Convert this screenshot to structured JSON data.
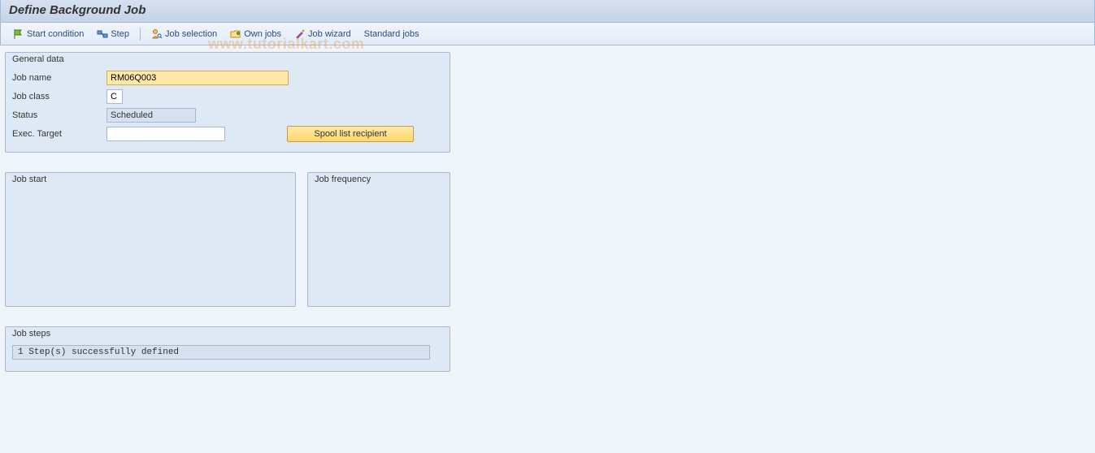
{
  "title": "Define Background Job",
  "toolbar": {
    "start_condition": "Start condition",
    "step": "Step",
    "job_selection": "Job selection",
    "own_jobs": "Own jobs",
    "job_wizard": "Job wizard",
    "standard_jobs": "Standard jobs"
  },
  "general": {
    "title": "General data",
    "job_name_label": "Job name",
    "job_name_value": "RM06Q003",
    "job_class_label": "Job class",
    "job_class_value": "C",
    "status_label": "Status",
    "status_value": "Scheduled",
    "exec_target_label": "Exec. Target",
    "exec_target_value": "",
    "spool_button": "Spool list recipient"
  },
  "job_start": {
    "title": "Job start"
  },
  "job_frequency": {
    "title": "Job frequency"
  },
  "job_steps": {
    "title": "Job steps",
    "message": "1 Step(s) successfully defined"
  },
  "watermark": "www.tutorialkart.com"
}
